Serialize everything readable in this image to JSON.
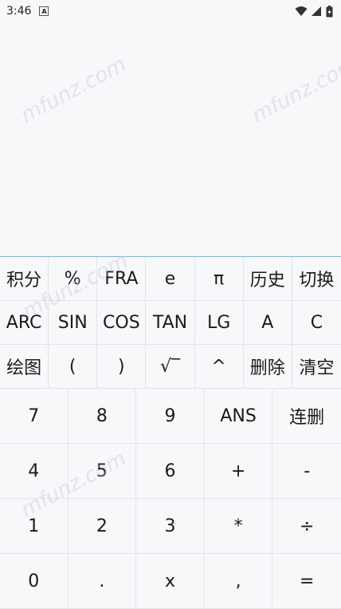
{
  "status": {
    "time": "3:46",
    "badge": "A"
  },
  "watermark": "mfunz.com",
  "display": {
    "expression": ""
  },
  "function_keys": [
    "积分",
    "%",
    "FRA",
    "e",
    "π",
    "历史",
    "切换",
    "ARC",
    "SIN",
    "COS",
    "TAN",
    "LG",
    "A",
    "C",
    "绘图",
    "(",
    ")",
    "√‾",
    "^",
    "删除",
    "清空"
  ],
  "number_keys": [
    "7",
    "8",
    "9",
    "ANS",
    "连删",
    "4",
    "5",
    "6",
    "+",
    "-",
    "1",
    "2",
    "3",
    "*",
    "÷",
    "0",
    ".",
    "x",
    ",",
    "="
  ]
}
